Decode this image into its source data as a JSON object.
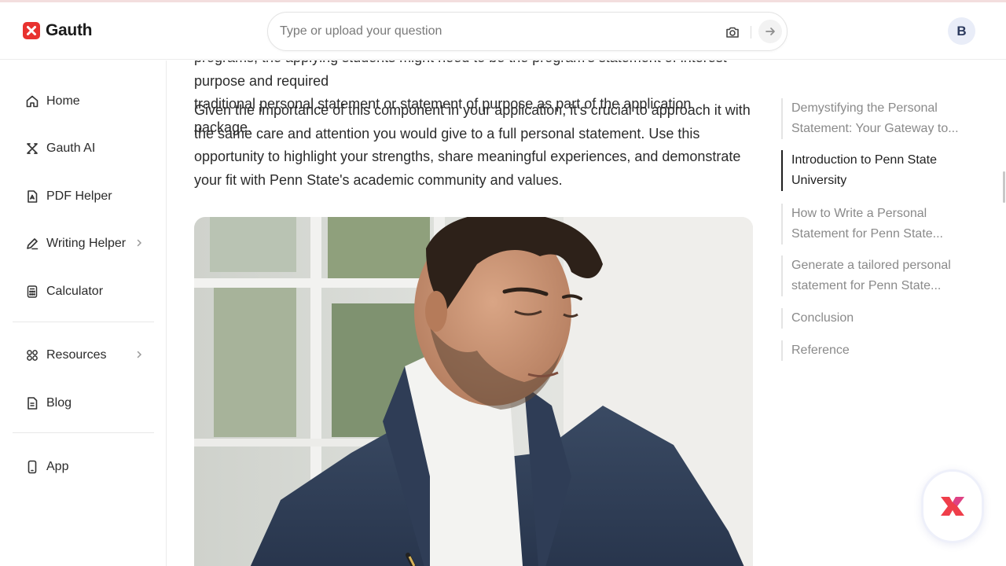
{
  "brand": {
    "name": "Gauth",
    "accent": "#e8322f"
  },
  "search": {
    "placeholder": "Type or upload your question"
  },
  "user": {
    "initial": "B"
  },
  "sidebar": {
    "items": [
      {
        "label": "Home",
        "icon": "home-icon"
      },
      {
        "label": "Gauth AI",
        "icon": "gauth-ai-icon"
      },
      {
        "label": "PDF Helper",
        "icon": "pdf-icon"
      },
      {
        "label": "Writing Helper",
        "icon": "pen-icon",
        "has_submenu": true
      },
      {
        "label": "Calculator",
        "icon": "calculator-icon"
      },
      {
        "label": "Resources",
        "icon": "grid-icon",
        "has_submenu": true
      },
      {
        "label": "Blog",
        "icon": "blog-icon"
      },
      {
        "label": "App",
        "icon": "phone-icon"
      }
    ]
  },
  "article": {
    "p1_partial": "programs, the applying students might need to be the program's statement of interest purpose and required",
    "p1_last": "traditional personal statement or statement of purpose as part of the application package.",
    "p2": "Given the importance of this component in your application, it's crucial to approach it with the same care and attention you would give to a full personal statement. Use this opportunity to highlight your strengths, share meaningful experiences, and demonstrate your fit with Penn State's academic community and values."
  },
  "toc": {
    "items": [
      {
        "label": "Demystifying the Personal Statement: Your Gateway to...",
        "active": false
      },
      {
        "label": "Introduction to Penn State University",
        "active": true
      },
      {
        "label": "How to Write a Personal Statement for Penn State...",
        "active": false
      },
      {
        "label": "Generate a tailored personal statement for Penn State...",
        "active": false
      },
      {
        "label": "Conclusion",
        "active": false
      },
      {
        "label": "Reference",
        "active": false
      }
    ]
  }
}
